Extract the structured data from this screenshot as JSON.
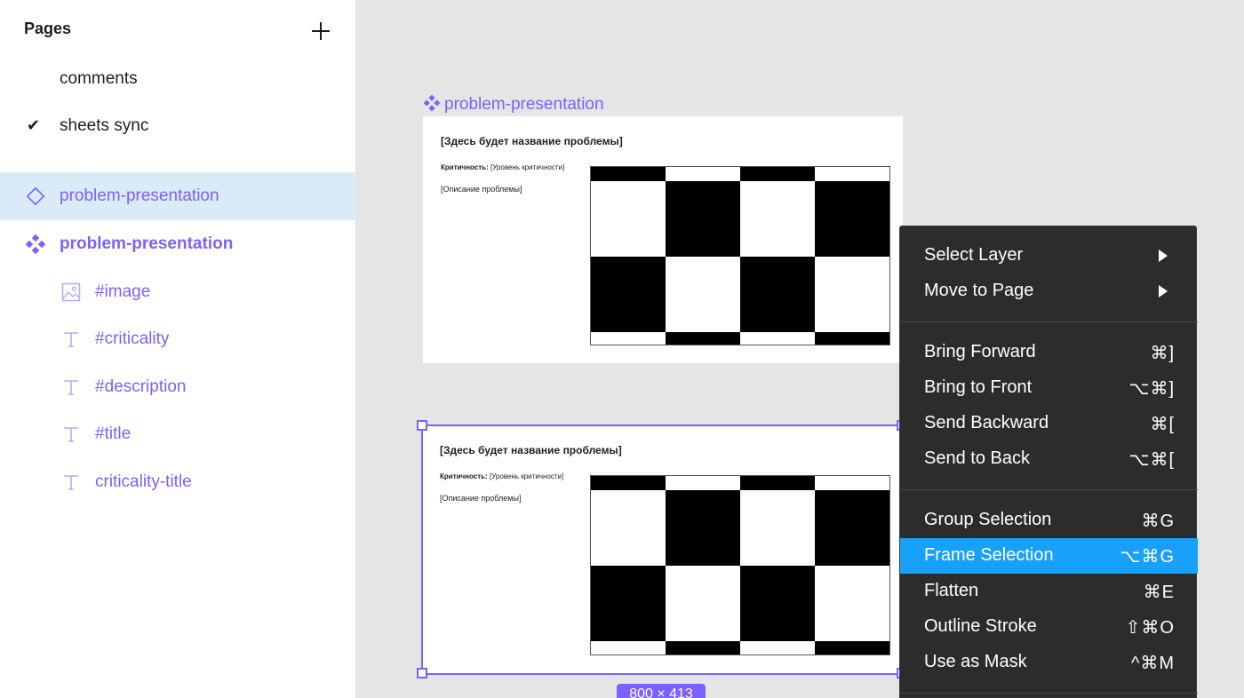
{
  "sidebar": {
    "pages_title": "Pages",
    "pages": [
      {
        "label": "comments",
        "checked": false
      },
      {
        "label": "sheets sync",
        "checked": true
      }
    ],
    "layers": [
      {
        "label": "problem-presentation",
        "icon": "component-instance-icon",
        "selected": true
      },
      {
        "label": "problem-presentation",
        "icon": "component-icon",
        "bold": true
      },
      {
        "label": "#image",
        "icon": "image-icon"
      },
      {
        "label": "#criticality",
        "icon": "text-icon"
      },
      {
        "label": "#description",
        "icon": "text-icon"
      },
      {
        "label": "#title",
        "icon": "text-icon"
      },
      {
        "label": "criticality-title",
        "icon": "text-icon"
      }
    ]
  },
  "canvas": {
    "frame_label": "problem-presentation",
    "frames": [
      {
        "title": "[Здесь будет название проблемы]",
        "criticality_label": "Критичность:",
        "criticality_value": "[Уровень критичности]",
        "description": "[Описание проблемы]"
      },
      {
        "title": "[Здесь будет название проблемы]",
        "criticality_label": "Критичность:",
        "criticality_value": "[Уровень критичности]",
        "description": "[Описание проблемы]"
      }
    ],
    "size_badge": "800 × 413"
  },
  "context_menu": {
    "groups": [
      [
        {
          "label": "Select Layer",
          "submenu": true
        },
        {
          "label": "Move to Page",
          "submenu": true
        }
      ],
      [
        {
          "label": "Bring Forward",
          "shortcut": "⌘]"
        },
        {
          "label": "Bring to Front",
          "shortcut": "⌥⌘]"
        },
        {
          "label": "Send Backward",
          "shortcut": "⌘["
        },
        {
          "label": "Send to Back",
          "shortcut": "⌥⌘["
        }
      ],
      [
        {
          "label": "Group Selection",
          "shortcut": "⌘G"
        },
        {
          "label": "Frame Selection",
          "shortcut": "⌥⌘G",
          "active": true
        },
        {
          "label": "Flatten",
          "shortcut": "⌘E"
        },
        {
          "label": "Outline Stroke",
          "shortcut": "⇧⌘O"
        },
        {
          "label": "Use as Mask",
          "shortcut": "^⌘M"
        }
      ]
    ]
  },
  "colors": {
    "accent": "#7b61ff",
    "selection_bg": "#daebf7",
    "menu_bg": "#2c2c2c",
    "menu_active": "#18a0fb"
  }
}
